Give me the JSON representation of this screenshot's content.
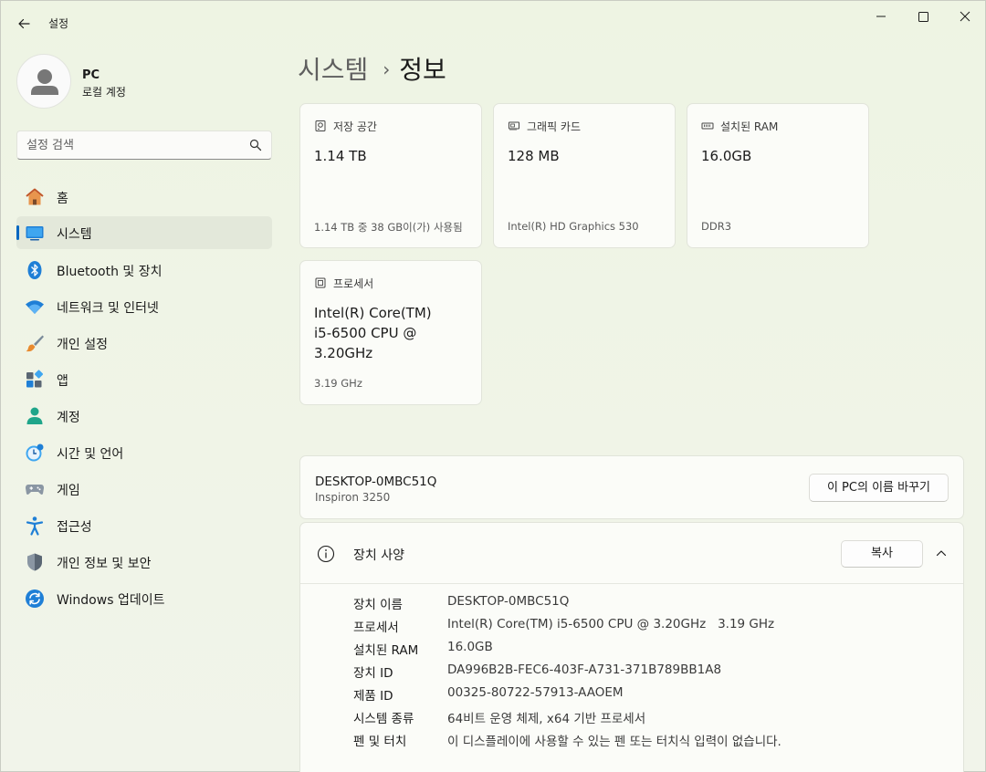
{
  "titlebar": {
    "title": "설정"
  },
  "profile": {
    "name": "PC",
    "account": "로컬 계정"
  },
  "search": {
    "placeholder": "설정 검색"
  },
  "sidebar": {
    "items": [
      {
        "label": "홈",
        "icon": "home-icon"
      },
      {
        "label": "시스템",
        "icon": "system-icon",
        "active": true
      },
      {
        "label": "Bluetooth 및 장치",
        "icon": "bluetooth-icon"
      },
      {
        "label": "네트워크 및 인터넷",
        "icon": "wifi-icon"
      },
      {
        "label": "개인 설정",
        "icon": "brush-icon"
      },
      {
        "label": "앱",
        "icon": "apps-icon"
      },
      {
        "label": "계정",
        "icon": "account-icon"
      },
      {
        "label": "시간 및 언어",
        "icon": "clock-globe-icon"
      },
      {
        "label": "게임",
        "icon": "gamepad-icon"
      },
      {
        "label": "접근성",
        "icon": "accessibility-icon"
      },
      {
        "label": "개인 정보 및 보안",
        "icon": "shield-icon"
      },
      {
        "label": "Windows 업데이트",
        "icon": "update-icon"
      }
    ]
  },
  "breadcrumb": {
    "parent": "시스템",
    "separator": "›",
    "current": "정보"
  },
  "cards": {
    "storage": {
      "title": "저장 공간",
      "value": "1.14 TB",
      "sub": "1.14 TB 중 38 GB이(가) 사용됨"
    },
    "graphics": {
      "title": "그래픽 카드",
      "value": "128 MB",
      "sub": "Intel(R) HD Graphics 530"
    },
    "ram": {
      "title": "설치된 RAM",
      "value": "16.0GB",
      "sub": "DDR3"
    },
    "processor": {
      "title": "프로세서",
      "value": "Intel(R) Core(TM) i5-6500 CPU @ 3.20GHz",
      "sub": "3.19 GHz"
    }
  },
  "device": {
    "name": "DESKTOP-0MBC51Q",
    "model": "Inspiron 3250",
    "rename_label": "이 PC의 이름 바꾸기"
  },
  "specs": {
    "title": "장치 사양",
    "copy_label": "복사",
    "rows": [
      {
        "label": "장치 이름",
        "value": "DESKTOP-0MBC51Q"
      },
      {
        "label": "프로세서",
        "value": "Intel(R) Core(TM) i5-6500 CPU @ 3.20GHz   3.19 GHz"
      },
      {
        "label": "설치된 RAM",
        "value": "16.0GB"
      },
      {
        "label": "장치 ID",
        "value": "DA996B2B-FEC6-403F-A731-371B789BB1A8"
      },
      {
        "label": "제품 ID",
        "value": "00325-80722-57913-AAOEM"
      },
      {
        "label": "시스템 종류",
        "value": "64비트 운영 체제, x64 기반 프로세서"
      },
      {
        "label": "펜 및 터치",
        "value": "이 디스플레이에 사용할 수 있는 펜 또는 터치식 입력이 없습니다."
      }
    ]
  },
  "colors": {
    "accent": "#0067c0",
    "background": "#eef3e4",
    "card": "#fbfcf8"
  }
}
